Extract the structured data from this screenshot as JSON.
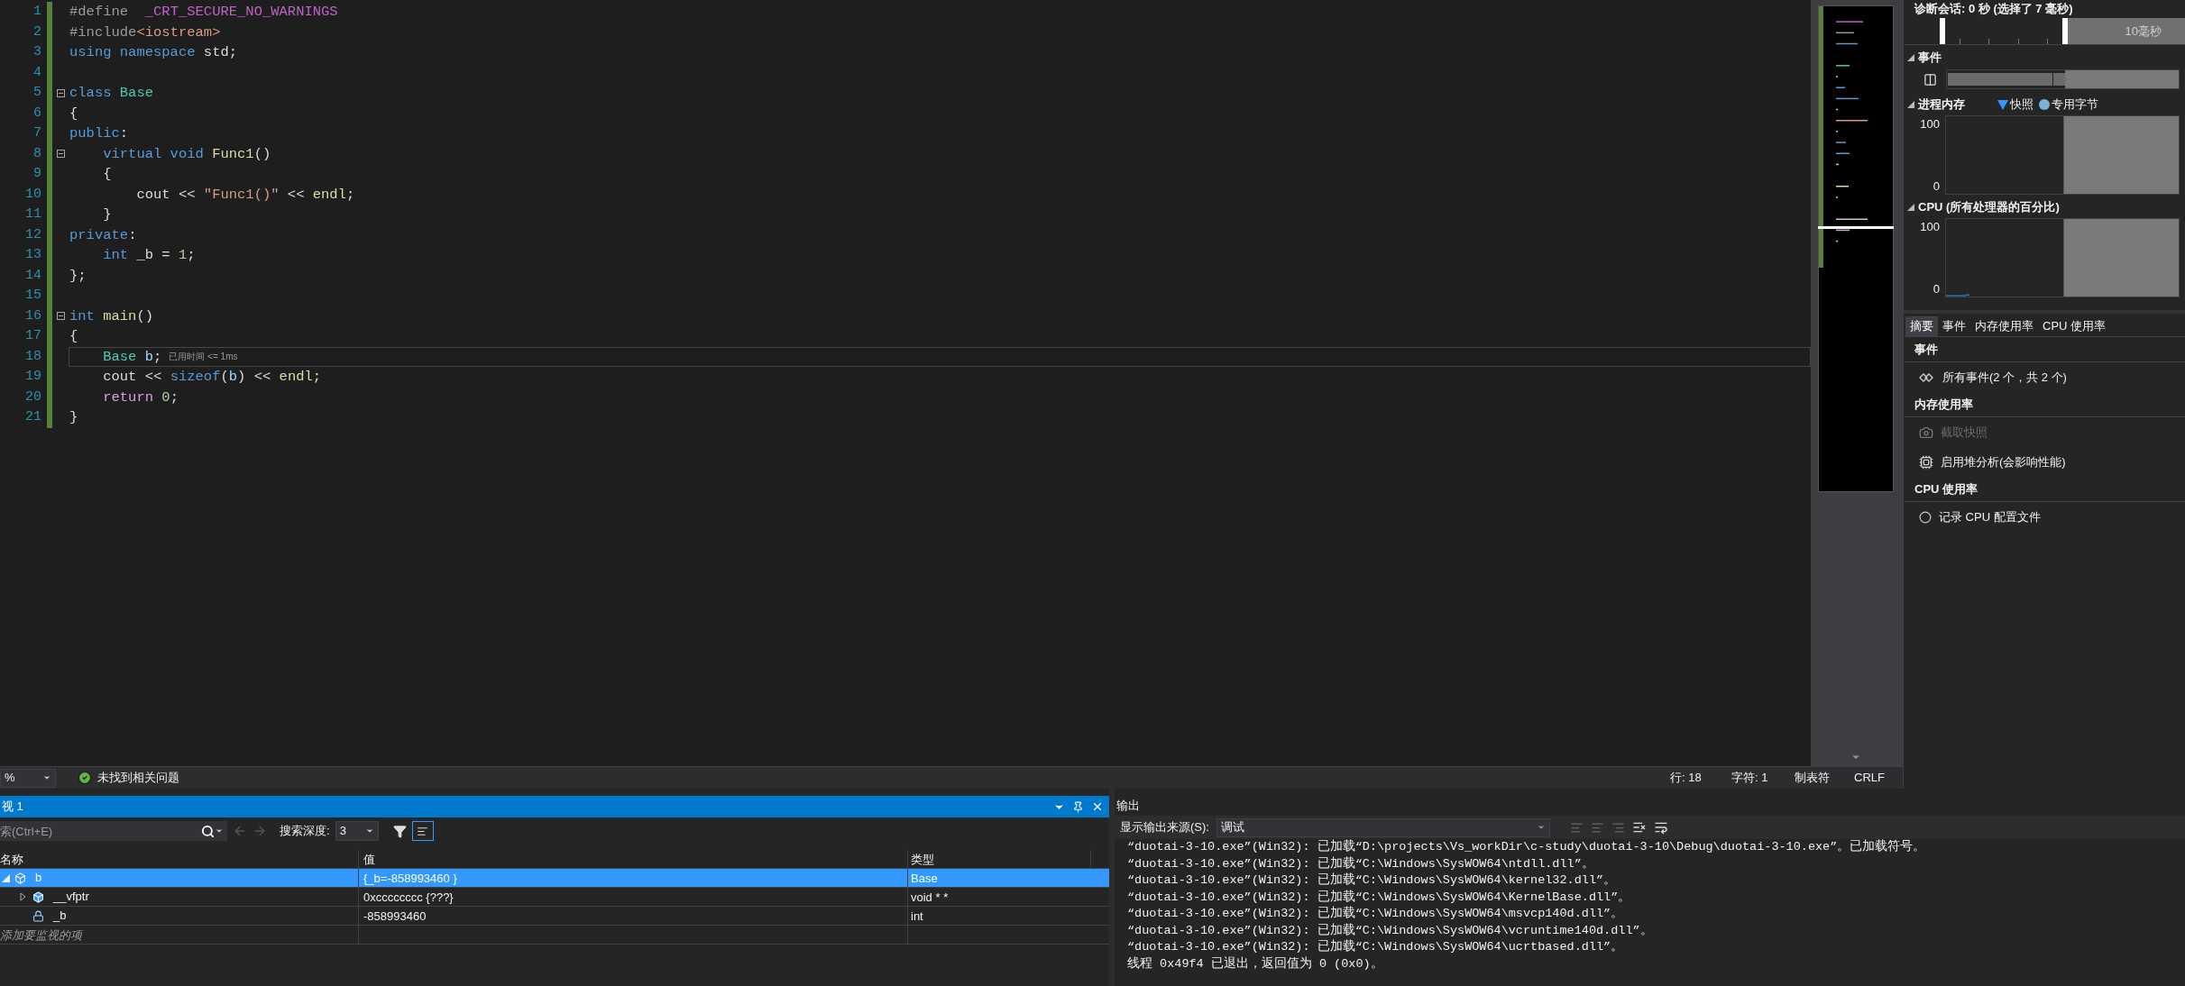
{
  "editor": {
    "lines": [
      {
        "number": "1",
        "fold": false,
        "current": false,
        "tokens": [
          {
            "text": "#define",
            "kind": "pre"
          },
          {
            "text": "  _CRT_SECURE_NO_WARNINGS",
            "kind": "macro"
          }
        ]
      },
      {
        "number": "2",
        "fold": false,
        "current": false,
        "tokens": [
          {
            "text": "#include",
            "kind": "pre"
          },
          {
            "text": "<iostream>",
            "kind": "str"
          }
        ]
      },
      {
        "number": "3",
        "fold": false,
        "current": false,
        "tokens": [
          {
            "text": "using namespace",
            "kind": "kw"
          },
          {
            "text": " std;",
            "kind": "text"
          }
        ]
      },
      {
        "number": "4",
        "fold": false,
        "current": false
      },
      {
        "number": "5",
        "fold": true,
        "current": false,
        "tokens": [
          {
            "text": "class",
            "kind": "kw"
          },
          {
            "text": " Base",
            "kind": "type"
          }
        ]
      },
      {
        "number": "6",
        "fold": false,
        "current": false,
        "tokens": [
          {
            "text": "{",
            "kind": "text"
          }
        ]
      },
      {
        "number": "7",
        "fold": false,
        "current": false,
        "tokens": [
          {
            "text": "public",
            "kind": "kw"
          },
          {
            "text": ":",
            "kind": "text"
          }
        ]
      },
      {
        "number": "8",
        "fold": true,
        "current": false,
        "tokens": [
          {
            "text": "    virtual void",
            "kind": "kw"
          },
          {
            "text": " Func1",
            "kind": "fn"
          },
          {
            "text": "()",
            "kind": "text"
          }
        ]
      },
      {
        "number": "9",
        "fold": false,
        "current": false,
        "tokens": [
          {
            "text": "    {",
            "kind": "text"
          }
        ]
      },
      {
        "number": "10",
        "fold": false,
        "current": false,
        "tokens": [
          {
            "text": "        cout << ",
            "kind": "text"
          },
          {
            "text": "\"Func1()\"",
            "kind": "str"
          },
          {
            "text": " << ",
            "kind": "text"
          },
          {
            "text": "endl",
            "kind": "fn"
          },
          {
            "text": ";",
            "kind": "text"
          }
        ]
      },
      {
        "number": "11",
        "fold": false,
        "current": false,
        "tokens": [
          {
            "text": "    }",
            "kind": "text"
          }
        ]
      },
      {
        "number": "12",
        "fold": false,
        "current": false,
        "tokens": [
          {
            "text": "private",
            "kind": "kw"
          },
          {
            "text": ":",
            "kind": "text"
          }
        ]
      },
      {
        "number": "13",
        "fold": false,
        "current": false,
        "tokens": [
          {
            "text": "    int",
            "kind": "kw"
          },
          {
            "text": " _b = ",
            "kind": "text"
          },
          {
            "text": "1",
            "kind": "num"
          },
          {
            "text": ";",
            "kind": "text"
          }
        ]
      },
      {
        "number": "14",
        "fold": false,
        "current": false,
        "tokens": [
          {
            "text": "};",
            "kind": "text"
          }
        ]
      },
      {
        "number": "15",
        "fold": false,
        "current": false
      },
      {
        "number": "16",
        "fold": true,
        "current": false,
        "tokens": [
          {
            "text": "int",
            "kind": "kw"
          },
          {
            "text": " main",
            "kind": "fn"
          },
          {
            "text": "()",
            "kind": "text"
          }
        ]
      },
      {
        "number": "17",
        "fold": false,
        "current": false,
        "tokens": [
          {
            "text": "{",
            "kind": "text"
          }
        ]
      },
      {
        "number": "18",
        "fold": false,
        "current": true,
        "hint": "已用时间 <= 1ms",
        "tokens": [
          {
            "text": "    Base",
            "kind": "type"
          },
          {
            "text": " b",
            "kind": "var"
          },
          {
            "text": ";",
            "kind": "text"
          }
        ]
      },
      {
        "number": "19",
        "fold": false,
        "current": false,
        "tokens": [
          {
            "text": "    cout << ",
            "kind": "text"
          },
          {
            "text": "sizeof",
            "kind": "kw"
          },
          {
            "text": "(",
            "kind": "text"
          },
          {
            "text": "b",
            "kind": "var"
          },
          {
            "text": ") << ",
            "kind": "text"
          },
          {
            "text": "endl",
            "kind": "fn"
          },
          {
            "text": ";",
            "kind": "text"
          }
        ]
      },
      {
        "number": "20",
        "fold": false,
        "current": false,
        "tokens": [
          {
            "text": "    return",
            "kind": "ctrl"
          },
          {
            "text": " 0",
            "kind": "num"
          },
          {
            "text": ";",
            "kind": "text"
          }
        ]
      },
      {
        "number": "21",
        "fold": false,
        "current": false,
        "tokens": [
          {
            "text": "}",
            "kind": "text"
          }
        ]
      }
    ]
  },
  "status_bar": {
    "zoom": "%",
    "issues": "未找到相关问题",
    "line": "行: 18",
    "char": "字符: 1",
    "indent": "制表符",
    "eol": "CRLF"
  },
  "diagnostics": {
    "title": "诊断会话: 0 秒 (选择了 7 毫秒)",
    "timeline_label": "10毫秒",
    "sections": [
      {
        "kind": "events",
        "title": "事件",
        "expanded": true
      },
      {
        "kind": "memory",
        "title": "进程内存",
        "expanded": true,
        "legend": [
          {
            "kind": "triangle",
            "label": "快照",
            "color": "#3794ff"
          },
          {
            "kind": "dot",
            "label": "专用字节",
            "color": "#75b4d6"
          }
        ],
        "y_max": "100",
        "y_min": "0"
      },
      {
        "kind": "cpu",
        "title": "CPU (所有处理器的百分比)",
        "expanded": true,
        "y_max": "100",
        "y_min": "0"
      }
    ],
    "tabs": [
      {
        "label": "摘要",
        "selected": true
      },
      {
        "label": "事件",
        "selected": false
      },
      {
        "label": "内存使用率",
        "selected": false
      },
      {
        "label": "CPU 使用率",
        "selected": false
      }
    ],
    "groups": [
      {
        "title": "事件",
        "items": [
          {
            "label": "所有事件(2 个，共 2 个)",
            "disabled": false
          }
        ]
      },
      {
        "title": "内存使用率",
        "items": [
          {
            "label": "截取快照",
            "disabled": true
          },
          {
            "label": "启用堆分析(会影响性能)",
            "disabled": false
          }
        ]
      },
      {
        "title": "CPU 使用率",
        "items": [
          {
            "label": "记录 CPU 配置文件",
            "disabled": false
          }
        ]
      }
    ]
  },
  "watch": {
    "title": "视 1",
    "search": {
      "placeholder": "索(Ctrl+E)"
    },
    "depth_label": "搜索深度:",
    "depth": "3",
    "columns": [
      "名称",
      "值",
      "类型"
    ],
    "rows": [
      {
        "name": "b",
        "value": "{_b=-858993460 }",
        "type": "Base",
        "kind": "object",
        "selected": true,
        "expanded": true,
        "children": [
          {
            "name": "__vfptr",
            "value": "0xcccccccc {???}",
            "type": "void * *",
            "kind": "object",
            "selected": false,
            "expanded": false,
            "has_children": true
          },
          {
            "name": "_b",
            "value": "-858993460",
            "type": "int",
            "kind": "field",
            "selected": false,
            "has_children": false
          }
        ]
      }
    ],
    "add_item": "添加要监视的项"
  },
  "output": {
    "title": "输出",
    "source_label": "显示输出来源(S):",
    "source": "调试",
    "lines": [
      "“duotai-3-10.exe”(Win32): 已加载“D:\\projects\\Vs_workDir\\c-study\\duotai-3-10\\Debug\\duotai-3-10.exe”。已加载符号。",
      "“duotai-3-10.exe”(Win32): 已加载“C:\\Windows\\SysWOW64\\ntdll.dll”。",
      "“duotai-3-10.exe”(Win32): 已加载“C:\\Windows\\SysWOW64\\kernel32.dll”。",
      "“duotai-3-10.exe”(Win32): 已加载“C:\\Windows\\SysWOW64\\KernelBase.dll”。",
      "“duotai-3-10.exe”(Win32): 已加载“C:\\Windows\\SysWOW64\\msvcp140d.dll”。",
      "“duotai-3-10.exe”(Win32): 已加载“C:\\Windows\\SysWOW64\\vcruntime140d.dll”。",
      "“duotai-3-10.exe”(Win32): 已加载“C:\\Windows\\SysWOW64\\ucrtbased.dll”。",
      "线程 0x49f4 已退出，返回值为 0 (0x0)。"
    ]
  }
}
